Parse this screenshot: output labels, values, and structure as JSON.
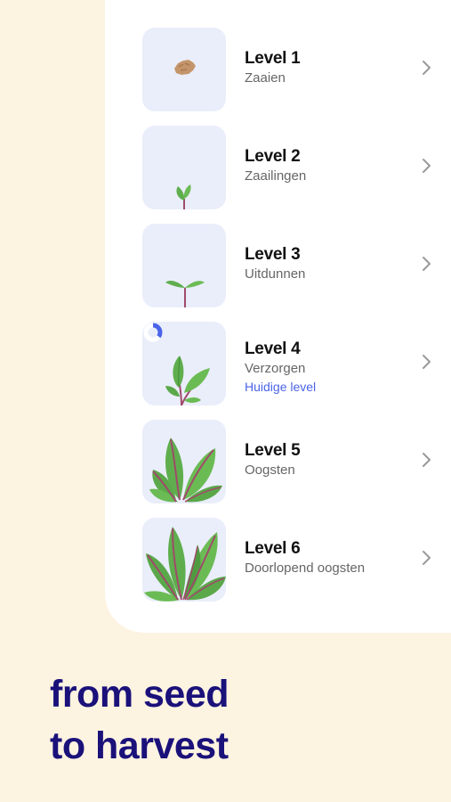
{
  "levels": [
    {
      "title": "Level 1",
      "subtitle": "Zaaien",
      "illustration": "seed-icon"
    },
    {
      "title": "Level 2",
      "subtitle": "Zaailingen",
      "illustration": "sprout-icon"
    },
    {
      "title": "Level 3",
      "subtitle": "Uitdunnen",
      "illustration": "seedling-icon"
    },
    {
      "title": "Level 4",
      "subtitle": "Verzorgen",
      "current_label": "Huidige level",
      "progress": 0.35,
      "illustration": "young-plant-icon"
    },
    {
      "title": "Level 5",
      "subtitle": "Oogsten",
      "illustration": "chard-plant-icon"
    },
    {
      "title": "Level 6",
      "subtitle": "Doorlopend oogsten",
      "illustration": "full-chard-plant-icon"
    }
  ],
  "tagline": {
    "line1": "from seed",
    "line2": "to harvest"
  },
  "colors": {
    "accent": "#4b63e8",
    "tagline": "#1a117a",
    "background": "#fdf3e1",
    "thumb": "#eaeefb"
  }
}
